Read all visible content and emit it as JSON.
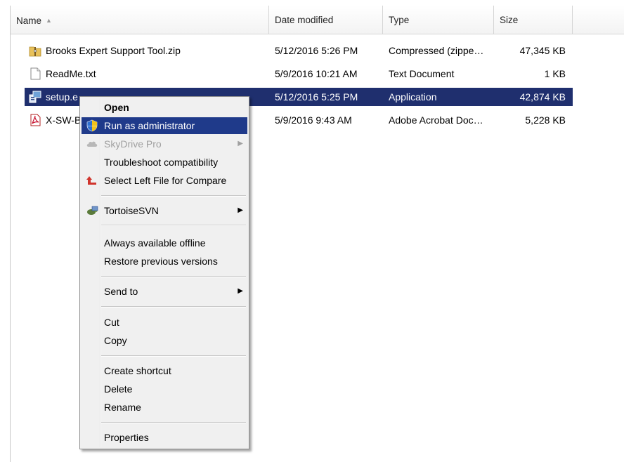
{
  "header": {
    "name": "Name",
    "date": "Date modified",
    "type": "Type",
    "size": "Size"
  },
  "files": [
    {
      "name": "Brooks Expert Support Tool.zip",
      "date": "5/12/2016 5:26 PM",
      "type": "Compressed (zippe…",
      "size": "47,345 KB",
      "icon": "zip-folder-icon"
    },
    {
      "name": "ReadMe.txt",
      "date": "5/9/2016 10:21 AM",
      "type": "Text Document",
      "size": "1 KB",
      "icon": "text-file-icon"
    },
    {
      "name": "setup.e",
      "date": "5/12/2016 5:25 PM",
      "type": "Application",
      "size": "42,874 KB",
      "icon": "setup-app-icon",
      "selected": true
    },
    {
      "name": "X-SW-Bl",
      "date": "5/9/2016 9:43 AM",
      "type": "Adobe Acrobat Doc…",
      "size": "5,228 KB",
      "icon": "pdf-file-icon"
    }
  ],
  "menu": {
    "open": "Open",
    "run_as_admin": "Run as administrator",
    "skydrive": "SkyDrive Pro",
    "troubleshoot": "Troubleshoot compatibility",
    "select_left": "Select Left File for Compare",
    "tortoise": "TortoiseSVN",
    "offline": "Always available offline",
    "restore": "Restore previous versions",
    "send_to": "Send to",
    "cut": "Cut",
    "copy": "Copy",
    "create_shortcut": "Create shortcut",
    "delete": "Delete",
    "rename": "Rename",
    "properties": "Properties"
  },
  "colors": {
    "selection": "#1f2f6e",
    "menu_highlight": "#1f3a8a",
    "menu_bg": "#f0f0f0"
  }
}
